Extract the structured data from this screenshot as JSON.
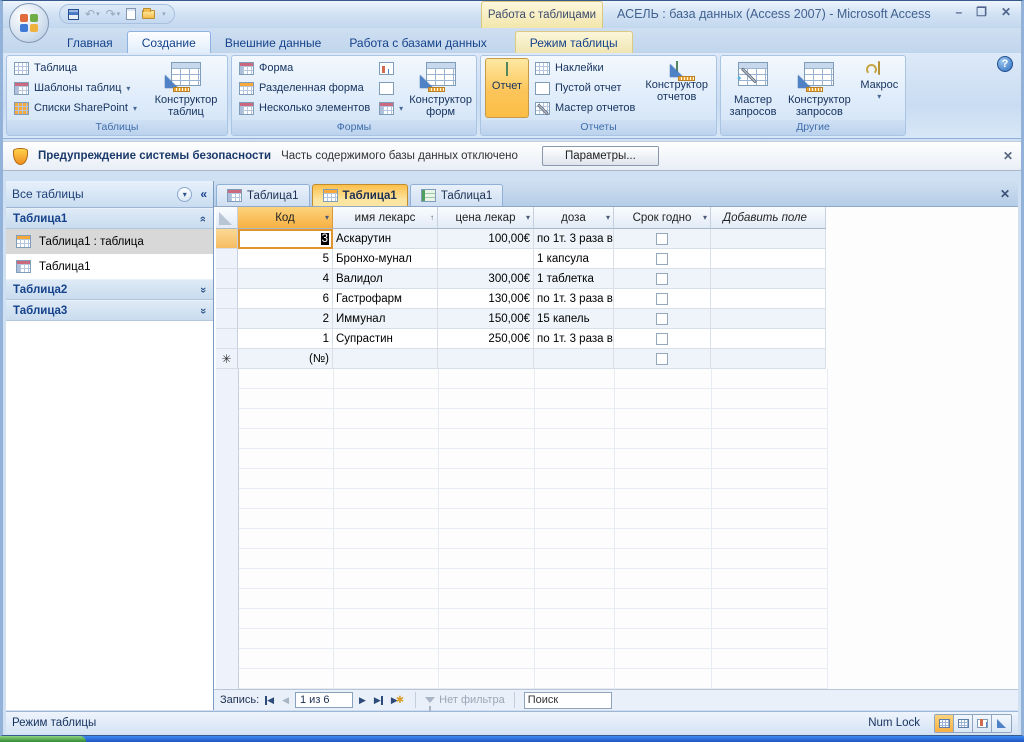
{
  "titlebar": {
    "title": "АСЕЛЬ : база данных (Access 2007) - Microsoft Access",
    "contextual_label": "Работа с таблицами"
  },
  "icons": {
    "dropdown": "▾",
    "chevron_double": "»",
    "collapse_pane": "«",
    "close": "✕",
    "minimize": "–",
    "maximize": "❐",
    "help": "?",
    "undo": "↶",
    "redo": "↷",
    "sort_asc": "↑",
    "nav_prev": "◀",
    "nav_next": "▶",
    "new_record_star": "✱",
    "new_row_marker": "✳",
    "sparkle": "✦"
  },
  "tabs": {
    "home": "Главная",
    "create": "Создание",
    "external": "Внешние данные",
    "dbtools": "Работа с базами данных",
    "datasheet_mode": "Режим таблицы"
  },
  "ribbon": {
    "tables": {
      "label": "Таблицы",
      "table": "Таблица",
      "templates": "Шаблоны таблиц",
      "sharepoint": "Списки SharePoint",
      "designer": "Конструктор таблиц"
    },
    "forms": {
      "label": "Формы",
      "form": "Форма",
      "split": "Разделенная форма",
      "multi": "Несколько элементов",
      "designer": "Конструктор форм"
    },
    "reports": {
      "label": "Отчеты",
      "report": "Отчет",
      "labels": "Наклейки",
      "blank": "Пустой отчет",
      "wizard": "Мастер отчетов",
      "designer": "Конструктор отчетов"
    },
    "other": {
      "label": "Другие",
      "query_wizard": "Мастер запросов",
      "query_designer": "Конструктор запросов",
      "macro": "Макрос"
    }
  },
  "security": {
    "title": "Предупреждение системы безопасности",
    "message": "Часть содержимого базы данных отключено",
    "options_button": "Параметры..."
  },
  "sidebar": {
    "header": "Все таблицы",
    "group1": "Таблица1",
    "item1": "Таблица1 : таблица",
    "item2": "Таблица1",
    "group2": "Таблица2",
    "group3": "Таблица3"
  },
  "doc_tabs": {
    "tab1": "Таблица1",
    "tab2": "Таблица1",
    "tab3": "Таблица1"
  },
  "table": {
    "headers": {
      "code": "Код",
      "name": "имя лекарс",
      "price": "цена лекар",
      "dose": "доза",
      "expiry": "Срок годно",
      "add_field": "Добавить поле"
    },
    "rows": [
      {
        "code": "3",
        "name": "Аскарутин",
        "price": "100,00€",
        "dose": "по 1т. 3 раза в"
      },
      {
        "code": "5",
        "name": "Бронхо-мунал",
        "price": "",
        "dose": "1 капсула"
      },
      {
        "code": "4",
        "name": "Валидол",
        "price": "300,00€",
        "dose": "1 таблетка"
      },
      {
        "code": "6",
        "name": "Гастрофарм",
        "price": "130,00€",
        "dose": "по 1т. 3 раза в"
      },
      {
        "code": "2",
        "name": "Иммунал",
        "price": "150,00€",
        "dose": "15 капель"
      },
      {
        "code": "1",
        "name": "Супрастин",
        "price": "250,00€",
        "dose": "по 1т. 3 раза в"
      }
    ],
    "new_row_label": "(№)"
  },
  "recnav": {
    "label": "Запись:",
    "position": "1 из 6",
    "no_filter": "Нет фильтра",
    "search_placeholder": "Поиск"
  },
  "status": {
    "mode": "Режим таблицы",
    "numlock": "Num Lock"
  }
}
